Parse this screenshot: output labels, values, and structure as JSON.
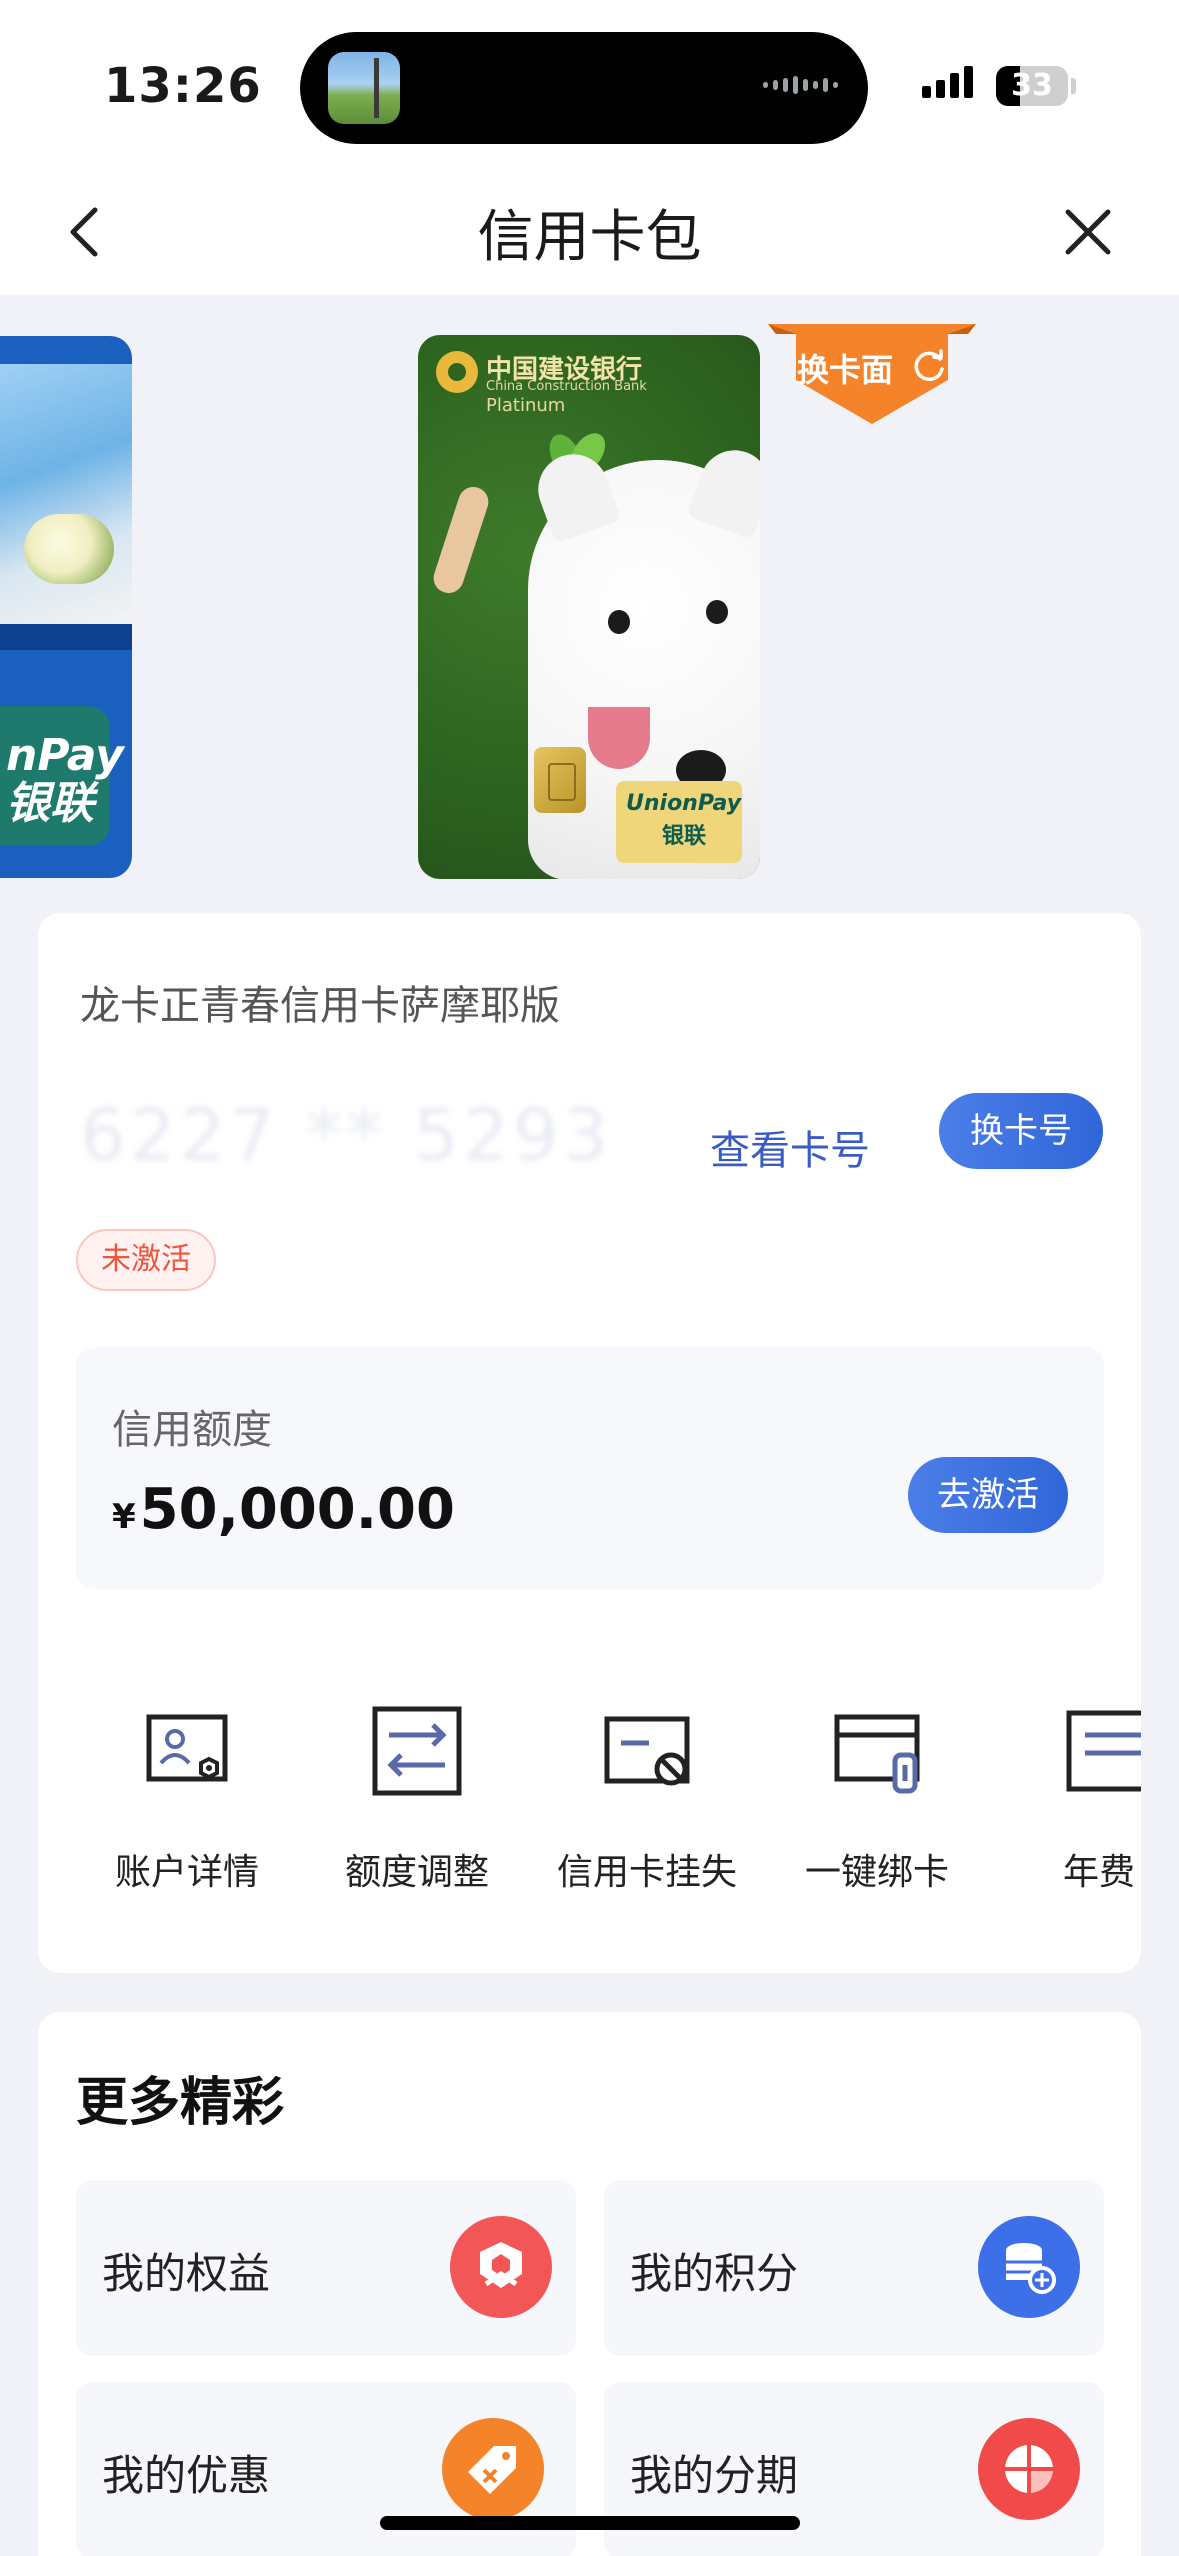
{
  "status_bar": {
    "time": "13:26",
    "battery": "33"
  },
  "nav": {
    "title": "信用卡包"
  },
  "card_art": {
    "swap_face_label": "换卡面",
    "bank_name": "中国建设银行",
    "bank_name_en": "China Construction Bank",
    "tier": "Platinum",
    "unionpay_en": "UnionPay",
    "unionpay_cn": "银联",
    "left_card_unionpay": "nPay",
    "left_card_unionpay_cn": "银联"
  },
  "card_info": {
    "title": "龙卡正青春信用卡萨摩耶版",
    "number_masked": "6227 ** 5293",
    "view_number": "查看卡号",
    "swap_number": "换卡号",
    "status": "未激活"
  },
  "credit": {
    "label": "信用额度",
    "currency": "¥",
    "amount": "50,000.00",
    "activate": "去激活"
  },
  "actions": [
    {
      "label": "账户详情",
      "icon": "account-detail-icon"
    },
    {
      "label": "额度调整",
      "icon": "limit-adjust-icon"
    },
    {
      "label": "信用卡挂失",
      "icon": "report-loss-icon"
    },
    {
      "label": "一键绑卡",
      "icon": "bind-card-icon"
    },
    {
      "label": "年费",
      "icon": "annual-fee-icon"
    }
  ],
  "more": {
    "title": "更多精彩",
    "tiles": [
      {
        "label": "我的权益",
        "icon": "rights-icon",
        "color": "#f25656"
      },
      {
        "label": "我的积分",
        "icon": "points-icon",
        "color": "#3d6fe8"
      },
      {
        "label": "我的优惠",
        "icon": "coupon-icon",
        "color": "#f5832a"
      },
      {
        "label": "我的分期",
        "icon": "installment-icon",
        "color": "#f04a4a"
      }
    ]
  },
  "colors": {
    "accent": "#3a5bc4",
    "orange": "#f5832a",
    "status_red": "#f0543c"
  }
}
